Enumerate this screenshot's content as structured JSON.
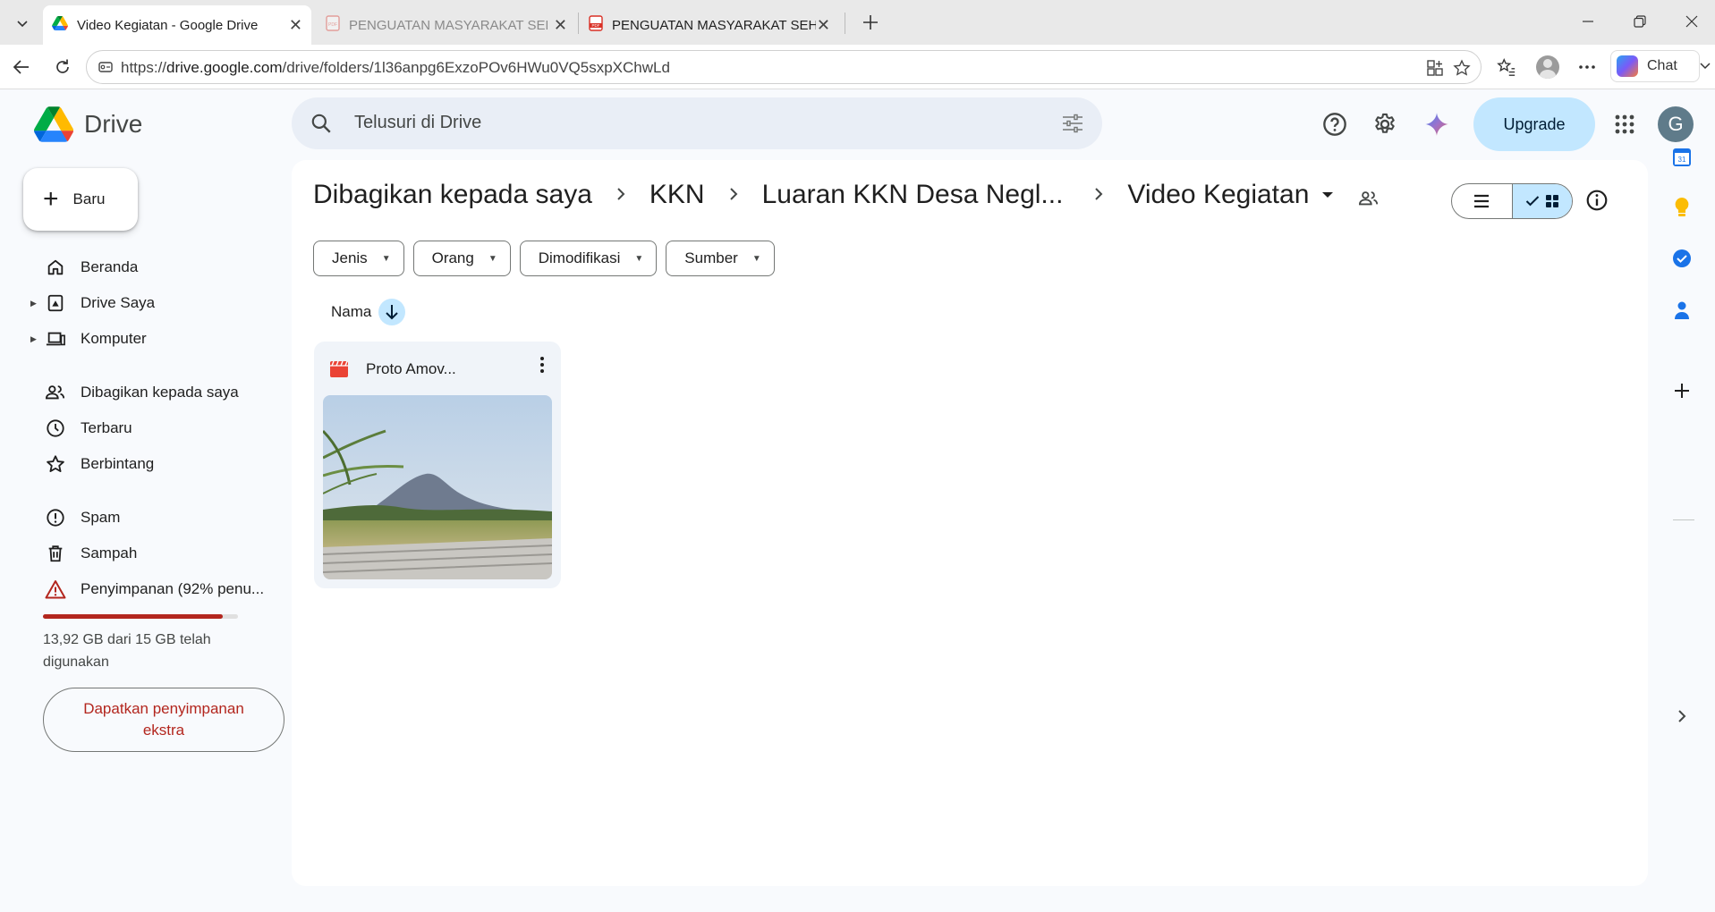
{
  "browser": {
    "tabs": [
      {
        "title": "Video Kegiatan - Google Drive",
        "active": true
      },
      {
        "title": "PENGUATAN MASYARAKAT SEHAT",
        "active": false
      },
      {
        "title": "PENGUATAN MASYARAKAT SEHAT",
        "active": false
      }
    ],
    "url_prefix": "https://",
    "url_domain": "drive.google.com",
    "url_path": "/drive/folders/1l36anpg6ExzoPOv6HWu0VQ5sxpXChwLd",
    "chat_label": "Chat"
  },
  "drive": {
    "logo_text": "Drive",
    "search_placeholder": "Telusuri di Drive",
    "upgrade_label": "Upgrade",
    "user_initial": "G"
  },
  "sidebar": {
    "new_label": "Baru",
    "items": [
      {
        "label": "Beranda"
      },
      {
        "label": "Drive Saya"
      },
      {
        "label": "Komputer"
      },
      {
        "label": "Dibagikan kepada saya"
      },
      {
        "label": "Terbaru"
      },
      {
        "label": "Berbintang"
      },
      {
        "label": "Spam"
      },
      {
        "label": "Sampah"
      },
      {
        "label": "Penyimpanan (92% penu..."
      }
    ],
    "storage_used_fraction": 0.92,
    "storage_text": "13,92 GB dari 15 GB telah digunakan",
    "get_storage_label": "Dapatkan penyimpanan ekstra"
  },
  "main": {
    "breadcrumbs": [
      "Dibagikan kepada saya",
      "KKN",
      "Luaran KKN Desa Negl...",
      "Video Kegiatan"
    ],
    "filters": [
      "Jenis",
      "Orang",
      "Dimodifikasi",
      "Sumber"
    ],
    "sort_label": "Nama",
    "files": [
      {
        "name": "Proto Amov...",
        "type": "video"
      }
    ]
  },
  "colors": {
    "accent": "#c2e7ff",
    "warning": "#b3261e",
    "search_bg": "#e9eef6"
  }
}
